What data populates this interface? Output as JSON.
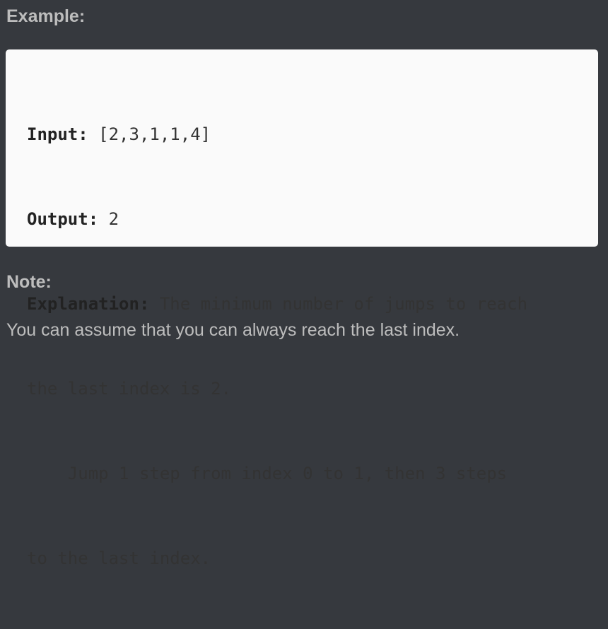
{
  "example": {
    "heading": "Example:",
    "lines": [
      {
        "label": "Input:",
        "text": " [2,3,1,1,4]"
      },
      {
        "label": "Output:",
        "text": " 2"
      },
      {
        "label": "Explanation:",
        "text": " The minimum number of jumps to reach"
      },
      {
        "label": "",
        "text": "the last index is 2."
      },
      {
        "label": "",
        "text": "    Jump 1 step from index 0 to 1, then 3 steps"
      },
      {
        "label": "",
        "text": "to the last index."
      }
    ]
  },
  "note": {
    "heading": "Note:",
    "text": "You can assume that you can always reach the last index."
  }
}
